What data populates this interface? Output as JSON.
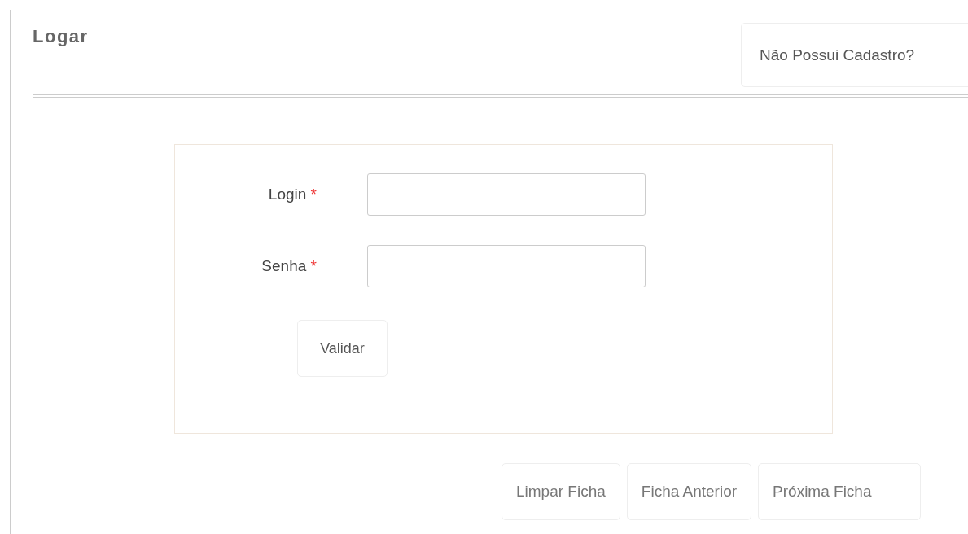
{
  "heading": "Logar",
  "register_button": "Não Possui Cadastro?",
  "form": {
    "fields": [
      {
        "label": "Login",
        "required": true
      },
      {
        "label": "Senha",
        "required": true
      }
    ],
    "required_mark": "*",
    "submit": "Validar"
  },
  "footer_buttons": [
    "Limpar Ficha",
    "Ficha Anterior",
    "Próxima Ficha"
  ]
}
